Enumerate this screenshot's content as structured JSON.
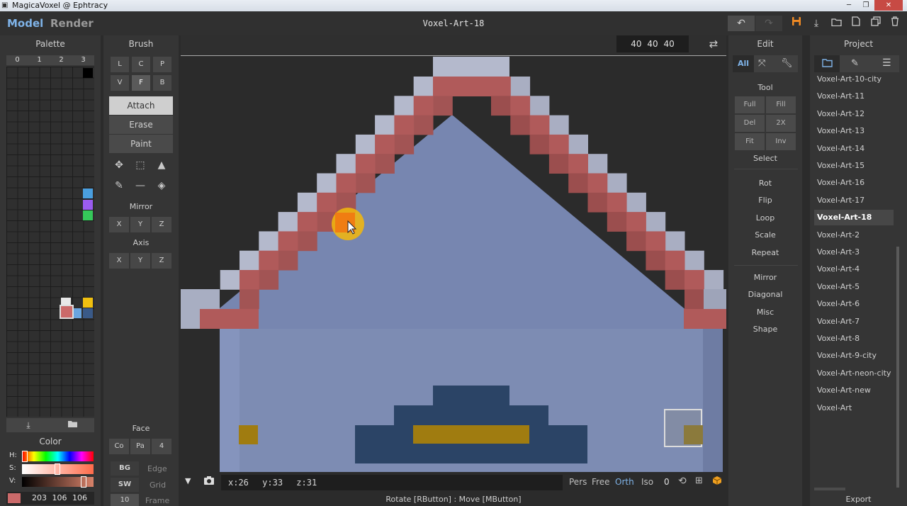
{
  "window": {
    "title": "MagicaVoxel @ Ephtracy"
  },
  "header": {
    "modes": [
      "Model",
      "Render"
    ],
    "doc_title": "Voxel-Art-18"
  },
  "palette": {
    "title": "Palette",
    "tabs": [
      "0",
      "1",
      "2",
      "3"
    ],
    "color_title": "Color",
    "h_label": "H:",
    "s_label": "S:",
    "v_label": "V:",
    "rgb": "203 106 106",
    "swatches": [
      "#000000",
      "#4a9fe0",
      "#9b5cf0",
      "#35c85a",
      "#e8e8e8",
      "#f0c010",
      "#cb6a6a",
      "#6aa5e0",
      "#3a5a88"
    ]
  },
  "brush": {
    "title": "Brush",
    "modes_row1": [
      "L",
      "C",
      "P"
    ],
    "modes_row2": [
      "V",
      "F",
      "B"
    ],
    "actions": [
      "Attach",
      "Erase",
      "Paint"
    ],
    "mirror_title": "Mirror",
    "axis_title": "Axis",
    "xyz": [
      "X",
      "Y",
      "Z"
    ],
    "face_title": "Face",
    "face_buttons": [
      "Co",
      "Pa",
      "4"
    ],
    "bg_label": "BG",
    "edge_label": "Edge",
    "sw_label": "SW",
    "grid_label": "Grid",
    "frame_value": "10",
    "frame_label": "Frame"
  },
  "viewport": {
    "dims": "40 40 40",
    "coords": {
      "x": "x:26",
      "y": "y:33",
      "z": "z:31"
    },
    "view_modes": [
      "Pers",
      "Free",
      "Orth",
      "Iso"
    ],
    "zero": "0",
    "hint": "Rotate [RButton] : Move [MButton]"
  },
  "edit": {
    "title": "Edit",
    "tabs": [
      "All"
    ],
    "tool_title": "Tool",
    "tool_buttons": [
      "Full",
      "Fill",
      "Del",
      "2X",
      "Fit",
      "Inv"
    ],
    "select_label": "Select",
    "ops": [
      "Rot",
      "Flip",
      "Loop",
      "Scale",
      "Repeat"
    ],
    "ops2": [
      "Mirror",
      "Diagonal",
      "Misc",
      "Shape"
    ]
  },
  "project": {
    "title": "Project",
    "items": [
      "Voxel-Art-10-city",
      "Voxel-Art-11",
      "Voxel-Art-12",
      "Voxel-Art-13",
      "Voxel-Art-14",
      "Voxel-Art-15",
      "Voxel-Art-16",
      "Voxel-Art-17",
      "Voxel-Art-18",
      "Voxel-Art-2",
      "Voxel-Art-3",
      "Voxel-Art-4",
      "Voxel-Art-5",
      "Voxel-Art-6",
      "Voxel-Art-7",
      "Voxel-Art-8",
      "Voxel-Art-9-city",
      "Voxel-Art-neon-city",
      "Voxel-Art-new",
      "Voxel-Art"
    ],
    "selected": "Voxel-Art-18",
    "export_label": "Export"
  }
}
